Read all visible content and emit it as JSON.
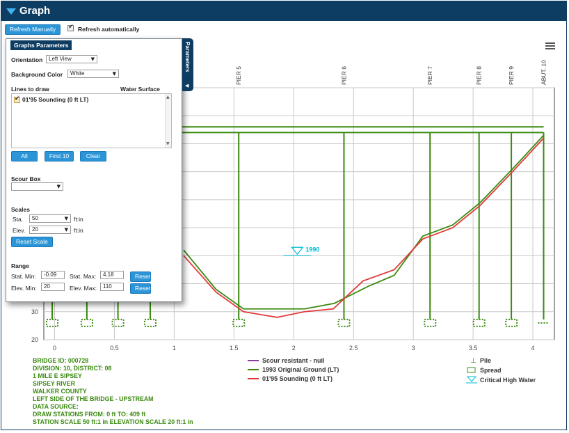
{
  "window": {
    "title": "Graph"
  },
  "toolbar": {
    "refresh_manual": "Refresh Manually",
    "refresh_auto_label": "Refresh automatically",
    "refresh_auto_checked": true
  },
  "params": {
    "title": "Graphs Parameters",
    "tab_label": "Parameters",
    "orientation_label": "Orientation",
    "orientation_value": "Left View",
    "bg_label": "Background Color",
    "bg_value": "White",
    "lines_label": "Lines to draw",
    "water_label": "Water Surface",
    "line_item": "01'95 Sounding (0 ft LT)",
    "btn_all": "All",
    "btn_first": "First 10",
    "btn_clear": "Clear",
    "scour_label": "Scour Box",
    "scour_value": "",
    "scales_label": "Scales",
    "sta_label": "Sta.",
    "sta_value": "50",
    "sta_unit": "ft:in",
    "elev_label": "Elev.",
    "elev_value": "20",
    "elev_unit": "ft:in",
    "reset_scale": "Reset Scale",
    "range_label": "Range",
    "stat_min_label": "Stat. Min:",
    "stat_min": "-0.09",
    "stat_max_label": "Stat. Max:",
    "stat_max": "4.18",
    "elev_min_label": "Elev. Min:",
    "elev_min": "20",
    "elev_max_label": "Elev. Max:",
    "elev_max": "110",
    "reset": "Reset"
  },
  "info": [
    "BRIDGE ID: 000728",
    "DIVISION: 10, DISTRICT: 08",
    "1 MILE E SIPSEY",
    "SIPSEY RIVER",
    "WALKER COUNTY",
    "LEFT SIDE OF THE BRIDGE - UPSTREAM",
    "DATA SOURCE:",
    "DRAW STATIONS FROM: 0 ft TO: 409 ft",
    "STATION SCALE 50 ft:1 in ELEVATION SCALE 20 ft:1 in"
  ],
  "colors": {
    "titlebar": "#0e3d63",
    "accent": "#3fb3f0",
    "button": "#2b95d8",
    "green": "#3a8a10",
    "red": "#e23a3a",
    "purple": "#8a3f9e",
    "cyan": "#00bcd4"
  },
  "chart_data": {
    "type": "line",
    "xlim": [
      -0.09,
      4.18
    ],
    "ylim": [
      20,
      110
    ],
    "x_ticks": [
      0,
      0.5,
      1,
      1.5,
      2,
      2.5,
      3,
      3.5,
      4
    ],
    "x_tick_labels": [
      "0",
      "0.5",
      "1",
      "1.5",
      "2",
      "2.5",
      "3",
      "3.5",
      "4"
    ],
    "y_ticks": [
      20,
      30
    ],
    "y_tick_labels": [
      "20",
      "30"
    ],
    "piers": [
      {
        "label": "PIER 5",
        "x": 1.54
      },
      {
        "label": "PIER 6",
        "x": 2.42
      },
      {
        "label": "PIER 7",
        "x": 3.14
      },
      {
        "label": "PIER 8",
        "x": 3.55
      },
      {
        "label": "PIER 9",
        "x": 3.82
      },
      {
        "label": "ABUT. 10",
        "x": 4.09
      }
    ],
    "left_piles_x": [
      -0.02,
      0.27,
      0.53,
      0.8
    ],
    "deck_elev": [
      96,
      94
    ],
    "water": {
      "label": "1990",
      "x": 2.03,
      "elev": 53
    },
    "legend": [
      {
        "name": "Scour resistant - null",
        "color": "#8a3f9e"
      },
      {
        "name": "1993 Original Ground (LT)",
        "color": "#3a8a10"
      },
      {
        "name": "01'95 Sounding (0 ft LT)",
        "color": "#e23a3a"
      }
    ],
    "symbol_legend": [
      "Pile",
      "Spread",
      "Critical High Water"
    ],
    "series": [
      {
        "name": "1993 Original Ground (LT)",
        "x": [
          1.08,
          1.35,
          1.58,
          1.86,
          2.09,
          2.34,
          2.62,
          2.84,
          3.08,
          3.33,
          3.56,
          3.83,
          4.09
        ],
        "y": [
          52,
          38,
          31,
          31,
          31,
          33,
          39,
          43,
          57,
          61,
          69,
          81,
          93
        ]
      },
      {
        "name": "01'95 Sounding (0 ft LT)",
        "x": [
          1.08,
          1.35,
          1.58,
          1.86,
          2.09,
          2.33,
          2.58,
          2.84,
          3.08,
          3.33,
          3.56,
          3.83,
          4.09
        ],
        "y": [
          50,
          37,
          30,
          28,
          30,
          31,
          41,
          45,
          56,
          60,
          68,
          80,
          92
        ]
      }
    ]
  }
}
